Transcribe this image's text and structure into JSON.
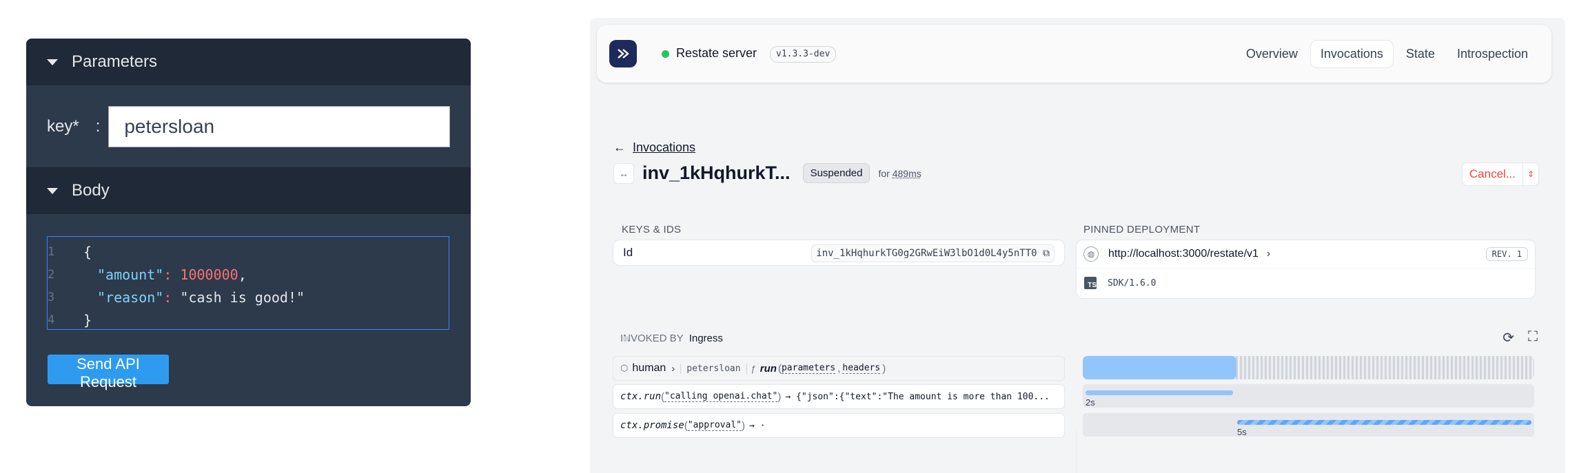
{
  "api_panel": {
    "parameters_title": "Parameters",
    "param_key_label": "key*",
    "param_colon": ":",
    "param_key_value": "petersloan",
    "body_title": "Body",
    "code_lines": [
      {
        "num": "1",
        "text": "{"
      },
      {
        "num": "2",
        "key": "\"amount\"",
        "value": "1000000",
        "trail": ","
      },
      {
        "num": "3",
        "key": "\"reason\"",
        "value": "\"cash is good!\"",
        "trail": ""
      },
      {
        "num": "4",
        "text": "}"
      }
    ],
    "send_button": "Send API Request"
  },
  "restate": {
    "server_name": "Restate server",
    "version": "v1.3.3-dev",
    "nav": [
      "Overview",
      "Invocations",
      "State",
      "Introspection"
    ],
    "nav_active": "Invocations",
    "breadcrumb": "Invocations",
    "invocation_id_short": "inv_1kHqhurkT...",
    "status": "Suspended",
    "for_prefix": "for",
    "for_duration": "489ms",
    "cancel_label": "Cancel...",
    "keys_ids_label": "KEYS & IDS",
    "id_label": "Id",
    "id_value": "inv_1kHqhurkTG0g2GRwEiW3lbO1d0L4y5nTT0",
    "pinned_deployment_label": "PINNED DEPLOYMENT",
    "deployment_url": "http://localhost:3000/restate/v1",
    "deployment_rev": "REV. 1",
    "sdk": "SDK/1.6.0",
    "invoked_by_label": "INVOKED BY",
    "invoked_by_value": "Ingress",
    "call": {
      "service": "human",
      "key": "petersloan",
      "fn_prefix": "ƒ",
      "handler": "run",
      "params": [
        "parameters",
        "headers"
      ]
    },
    "steps": [
      {
        "ctx": "ctx.run",
        "arg": "\"calling openai.chat\"",
        "result": "→ {\"json\":{\"text\":\"The amount is more than 100...",
        "bar_label": "2s",
        "bar_start": 0,
        "bar_end": 0.33
      },
      {
        "ctx": "ctx.promise",
        "arg": "\"approval\"",
        "result": "→ ·",
        "bar_label": "5s",
        "bar_start": 0.34,
        "bar_end": 1.0
      }
    ],
    "main_bar": {
      "start": 0,
      "end": 0.34
    },
    "accent_color": "#93c5fd",
    "status_color": "#22c55e",
    "cancel_color": "#ef4444"
  }
}
